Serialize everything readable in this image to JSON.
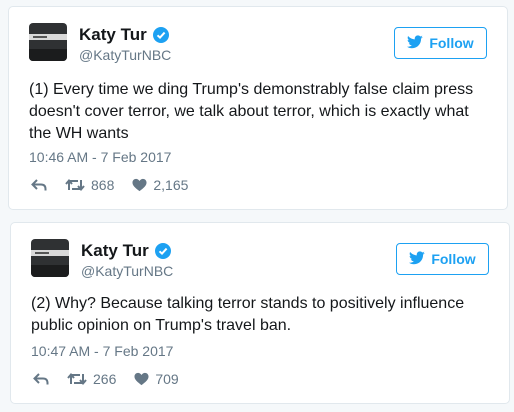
{
  "tweets": [
    {
      "author_name": "Katy Tur",
      "handle": "@KatyTurNBC",
      "follow_label": "Follow",
      "text": "(1) Every time we ding Trump's demonstrably false claim press doesn't cover terror, we talk about terror, which is exactly what the WH wants",
      "timestamp": "10:46 AM - 7 Feb 2017",
      "retweets": "868",
      "likes": "2,165"
    },
    {
      "author_name": "Katy Tur",
      "handle": "@KatyTurNBC",
      "follow_label": "Follow",
      "text": "(2) Why? Because talking terror stands to positively influence public opinion on Trump's travel ban.",
      "timestamp": "10:47 AM - 7 Feb 2017",
      "retweets": "266",
      "likes": "709"
    }
  ],
  "icons": {
    "verified": "verified-badge-icon",
    "follow": "twitter-bird-icon",
    "reply": "reply-icon",
    "retweet": "retweet-icon",
    "like": "heart-icon"
  },
  "colors": {
    "accent": "#1da1f2",
    "muted": "#657786",
    "text": "#14171a",
    "border": "#e1e8ed",
    "background": "#f5f8fa"
  }
}
